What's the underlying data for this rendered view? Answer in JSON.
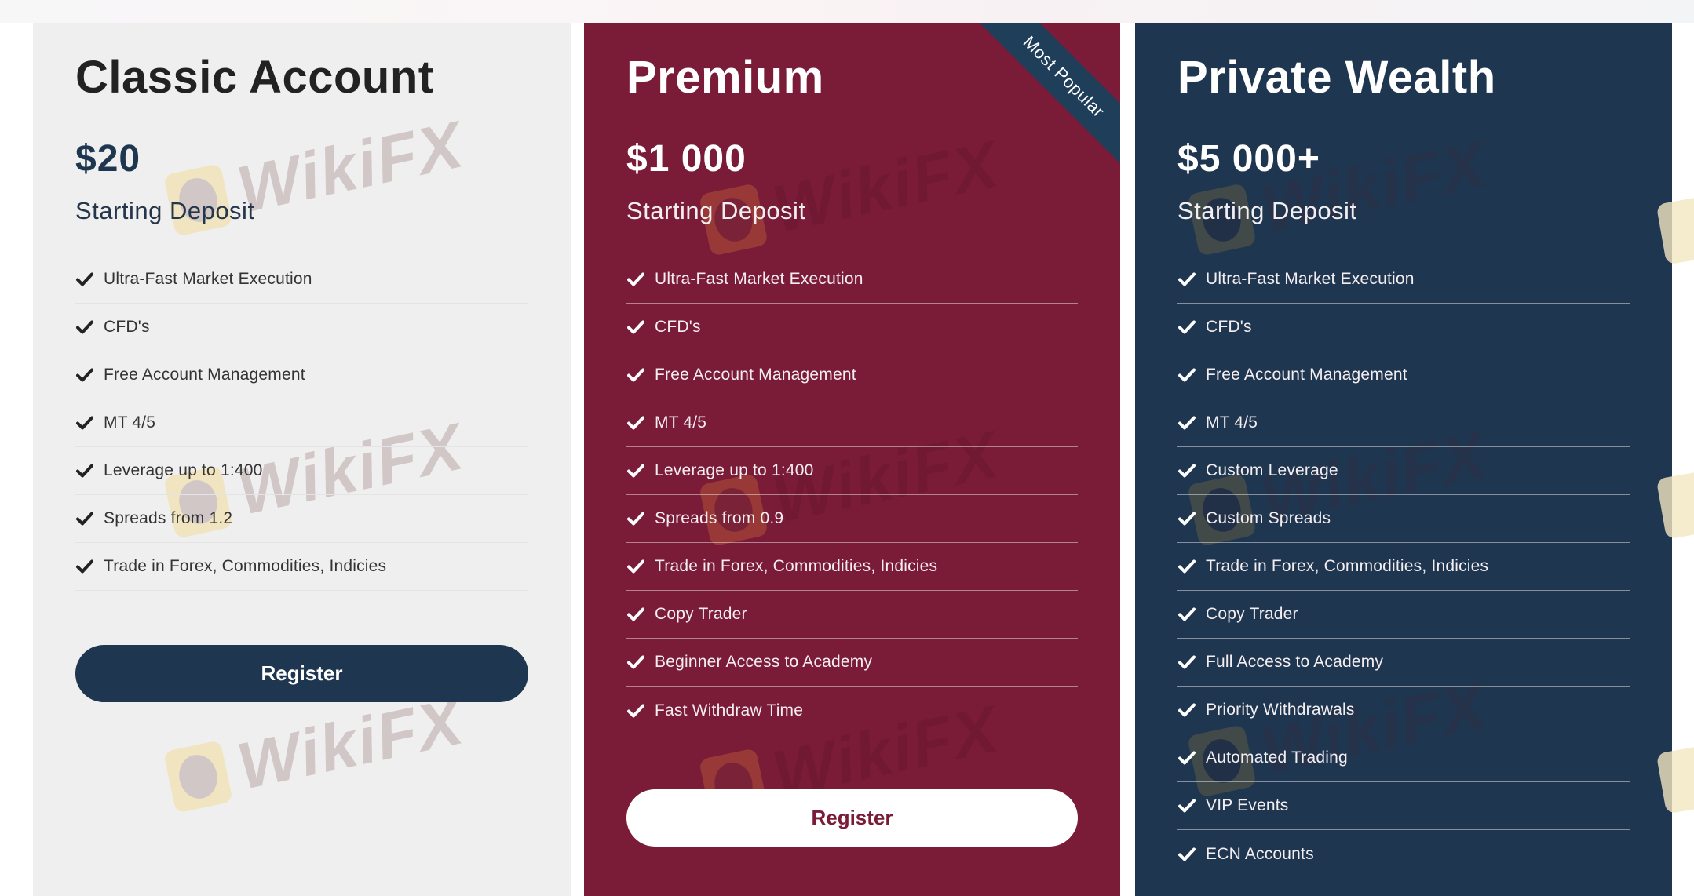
{
  "plans": [
    {
      "id": "classic",
      "title": "Classic Account",
      "price": "$20",
      "price_caption": "Starting Deposit",
      "ribbon": null,
      "features": [
        "Ultra-Fast Market Execution",
        "CFD's",
        "Free Account Management",
        "MT 4/5",
        "Leverage up to 1:400",
        "Spreads from 1.2",
        "Trade in Forex, Commodities, Indicies"
      ],
      "button_label": "Register",
      "colors": {
        "background": "#efefef",
        "button": "#1f3650"
      }
    },
    {
      "id": "premium",
      "title": "Premium",
      "price": "$1 000",
      "price_caption": "Starting Deposit",
      "ribbon": "Most Popular",
      "features": [
        "Ultra-Fast Market Execution",
        "CFD's",
        "Free Account Management",
        "MT 4/5",
        "Leverage up to 1:400",
        "Spreads from 0.9",
        "Trade in Forex, Commodities, Indicies",
        "Copy Trader",
        "Beginner Access to Academy",
        "Fast Withdraw Time"
      ],
      "button_label": "Register",
      "colors": {
        "background": "#7a1c37",
        "button": "#ffffff"
      }
    },
    {
      "id": "private",
      "title": "Private Wealth",
      "price": "$5 000+",
      "price_caption": "Starting Deposit",
      "ribbon": null,
      "features": [
        "Ultra-Fast Market Execution",
        "CFD's",
        "Free Account Management",
        "MT 4/5",
        "Custom Leverage",
        "Custom Spreads",
        "Trade in Forex, Commodities, Indicies",
        "Copy Trader",
        "Full Access to Academy",
        "Priority Withdrawals",
        "Automated Trading",
        "VIP Events",
        "ECN Accounts"
      ],
      "button_label": null,
      "colors": {
        "background": "#1f3650"
      }
    }
  ],
  "watermark": {
    "text": "WikiFX",
    "icon": "eagle-logo-icon"
  },
  "icons": {
    "feature_check": "checkmark-icon"
  }
}
